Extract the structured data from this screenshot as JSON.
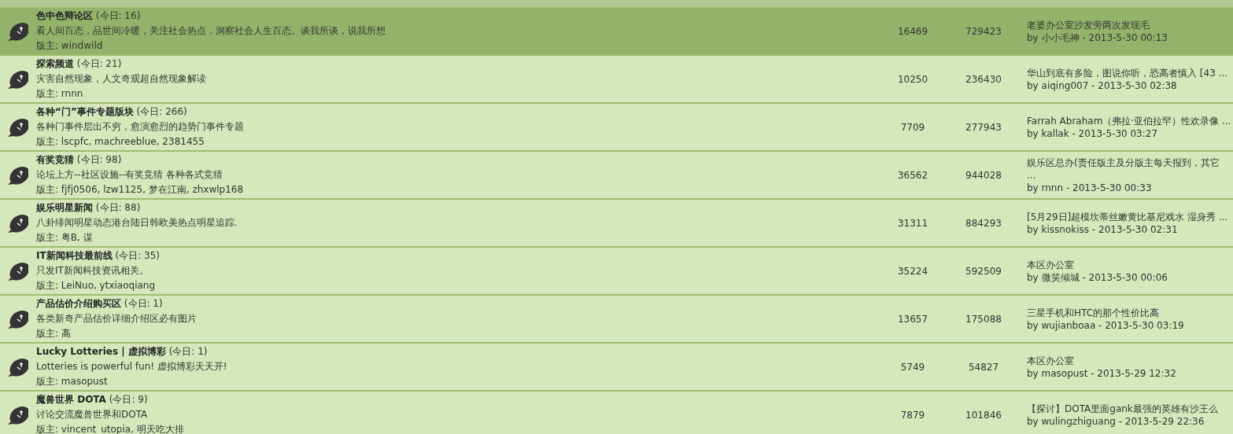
{
  "forums": [
    {
      "name": "色中色辩论区",
      "today": "(今日: 16)",
      "description": "看人间百态，品世间冷暖，关注社会热点，洞察社会人生百态。谈我所谈，说我所想",
      "moderators": "版主: windwild",
      "topics": "16469",
      "posts": "729423",
      "last_post": {
        "title_lines": [
          "老婆办公室沙发旁两次发现毛"
        ],
        "byline": "by 小小毛神 - 2013-5-30 00:13"
      },
      "selected": true
    },
    {
      "name": "探索频道",
      "today": "(今日: 21)",
      "description": "灾害自然现象，人文奇观超自然现象解读",
      "moderators": "版主: rnnn",
      "topics": "10250",
      "posts": "236430",
      "last_post": {
        "title_lines": [
          "华山到底有多险，图说你听，恐高者慎入 [43 ..."
        ],
        "byline": "by aiqing007 - 2013-5-30 02:38"
      },
      "selected": false
    },
    {
      "name": "各种“门”事件专题版块",
      "today": "(今日: 266)",
      "description": "各种门事件层出不穷，愈演愈烈的趋势门事件专题",
      "moderators": "版主: lscpfc, machreeblue, 2381455",
      "topics": "7709",
      "posts": "277943",
      "last_post": {
        "title_lines": [
          "Farrah Abraham（弗拉·亚伯拉罕）性欢录像 ..."
        ],
        "byline": "by kallak - 2013-5-30 03:27"
      },
      "selected": false
    },
    {
      "name": "有奖竞猜",
      "today": "(今日: 98)",
      "description": "论坛上方--社区设施--有奖竞猜 各种各式竞猜",
      "moderators": "版主: fjfj0506, lzw1125, 梦在江南, zhxwlp168",
      "topics": "36562",
      "posts": "944028",
      "last_post": {
        "title_lines": [
          "娱乐区总办(责任版主及分版主每天报到，其它",
          "..."
        ],
        "byline": "by rnnn - 2013-5-30 00:33"
      },
      "selected": false
    },
    {
      "name": "娱乐明星新闻",
      "today": "(今日: 88)",
      "description": "八卦绯闻明星动态港台陆日韩欧美热点明星追踪.",
      "moderators": "版主: 粤B, 谋",
      "topics": "31311",
      "posts": "884293",
      "last_post": {
        "title_lines": [
          "[5月29日]超模坎蒂丝嫩黄比基尼戏水 湿身秀 ..."
        ],
        "byline": "by kissnokiss - 2013-5-30 02:31"
      },
      "selected": false
    },
    {
      "name": "IT新闻科技最前线",
      "today": "(今日: 35)",
      "description": "只发IT新闻科技资讯相关。",
      "moderators": "版主: LeiNuo, ytxiaoqiang",
      "topics": "35224",
      "posts": "592509",
      "last_post": {
        "title_lines": [
          "本区办公室"
        ],
        "byline": "by 微笑倾城 - 2013-5-30 00:06"
      },
      "selected": false
    },
    {
      "name": "产品估价介绍购买区",
      "today": "(今日: 1)",
      "description": "各类新奇产品估价详细介绍区必有图片",
      "moderators": "版主: 高",
      "topics": "13657",
      "posts": "175088",
      "last_post": {
        "title_lines": [
          "三星手机和HTC的那个性价比高"
        ],
        "byline": "by wujianboaa - 2013-5-30 03:19"
      },
      "selected": false
    },
    {
      "name": "Lucky Lotteries | 虚拟博彩",
      "today": "(今日: 1)",
      "description": "Lotteries is powerful fun! 虚拟博彩天天开!",
      "moderators": "版主: masopust",
      "topics": "5749",
      "posts": "54827",
      "last_post": {
        "title_lines": [
          "本区办公室"
        ],
        "byline": "by masopust - 2013-5-29 12:32"
      },
      "selected": false
    },
    {
      "name": "魔兽世界 DOTA",
      "today": "(今日: 9)",
      "description": "讨论交流魔兽世界和DOTA",
      "moderators": "版主: vincent_utopia, 明天吃大排",
      "topics": "7879",
      "posts": "101846",
      "last_post": {
        "title_lines": [
          "【探讨】DOTA里面gank最强的英雄有沙王么"
        ],
        "byline": "by wulingzhiguang - 2013-5-29 22:36"
      },
      "selected": false
    }
  ]
}
